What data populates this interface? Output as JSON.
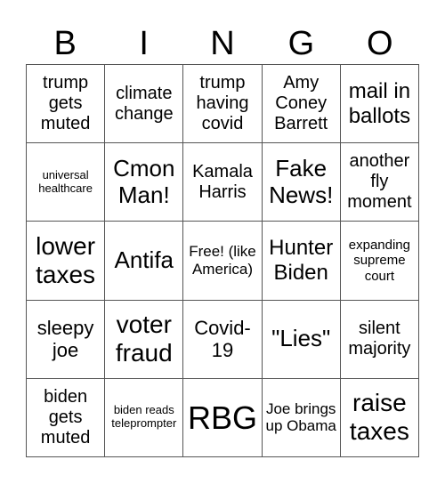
{
  "header": {
    "letters": [
      "B",
      "I",
      "N",
      "G",
      "O"
    ]
  },
  "cells": [
    "trump gets muted",
    "climate change",
    "trump having covid",
    "Amy Coney Barrett",
    "mail in ballots",
    "universal healthcare",
    "Cmon Man!",
    "Kamala Harris",
    "Fake News!",
    "another fly moment",
    "lower taxes",
    "Antifa",
    "Free! (like America)",
    "Hunter Biden",
    "expanding supreme court",
    "sleepy joe",
    "voter fraud",
    "Covid-19",
    "\"Lies\"",
    "silent majority",
    "biden gets muted",
    "biden reads teleprompter",
    "RBG",
    "Joe brings up Obama",
    "raise taxes"
  ]
}
